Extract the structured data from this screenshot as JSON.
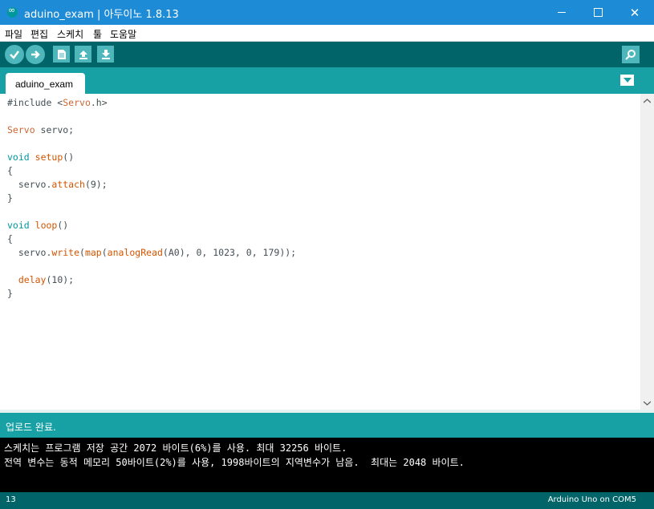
{
  "window": {
    "title": "aduino_exam | 아두이노 1.8.13",
    "minimize": "—",
    "maximize": "□",
    "close": "✕"
  },
  "menu": [
    "파일",
    "편집",
    "스케치",
    "툴",
    "도움말"
  ],
  "toolbar": {
    "verify_icon": "check-icon",
    "upload_icon": "arrow-right-icon",
    "new_icon": "new-file-icon",
    "open_icon": "upload-arrow-icon",
    "save_icon": "download-arrow-icon",
    "serial_monitor_icon": "magnifier-icon"
  },
  "tabs": [
    {
      "label": "aduino_exam",
      "active": true
    }
  ],
  "code_lines": [
    [
      {
        "t": "#include <",
        "c": "p"
      },
      {
        "t": "Servo",
        "c": "ty"
      },
      {
        "t": ".h>",
        "c": "p"
      }
    ],
    [],
    [
      {
        "t": "Servo",
        "c": "ty"
      },
      {
        "t": " servo;",
        "c": "p"
      }
    ],
    [],
    [
      {
        "t": "void",
        "c": "kw"
      },
      {
        "t": " ",
        "c": "p"
      },
      {
        "t": "setup",
        "c": "fn"
      },
      {
        "t": "()",
        "c": "p"
      }
    ],
    [
      {
        "t": "{",
        "c": "p"
      }
    ],
    [
      {
        "t": "  servo.",
        "c": "p"
      },
      {
        "t": "attach",
        "c": "fn"
      },
      {
        "t": "(9);",
        "c": "p"
      }
    ],
    [
      {
        "t": "}",
        "c": "p"
      }
    ],
    [],
    [
      {
        "t": "void",
        "c": "kw"
      },
      {
        "t": " ",
        "c": "p"
      },
      {
        "t": "loop",
        "c": "fn"
      },
      {
        "t": "()",
        "c": "p"
      }
    ],
    [
      {
        "t": "{",
        "c": "p"
      }
    ],
    [
      {
        "t": "  servo.",
        "c": "p"
      },
      {
        "t": "write",
        "c": "fn"
      },
      {
        "t": "(",
        "c": "p"
      },
      {
        "t": "map",
        "c": "fn"
      },
      {
        "t": "(",
        "c": "p"
      },
      {
        "t": "analogRead",
        "c": "fn"
      },
      {
        "t": "(A0), 0, 1023, 0, 179));",
        "c": "p"
      }
    ],
    [],
    [
      {
        "t": "  ",
        "c": "p"
      },
      {
        "t": "delay",
        "c": "fn"
      },
      {
        "t": "(10);",
        "c": "p"
      }
    ],
    [
      {
        "t": "}",
        "c": "p"
      }
    ]
  ],
  "status": "업로드 완료.",
  "console": [
    "스케치는 프로그램 저장 공간 2072 바이트(6%)를 사용. 최대 32256 바이트.",
    "전역 변수는 동적 메모리 50바이트(2%)를 사용, 1998바이트의 지역변수가 남음.  최대는 2048 바이트."
  ],
  "footer": {
    "line_number": "13",
    "board": "Arduino Uno on COM5"
  },
  "colors": {
    "titlebar": "#1e8bd6",
    "toolbar": "#006468",
    "tabbar": "#17a1a5",
    "keyword": "#00979c",
    "type": "#cc6633",
    "function": "#d35400"
  }
}
